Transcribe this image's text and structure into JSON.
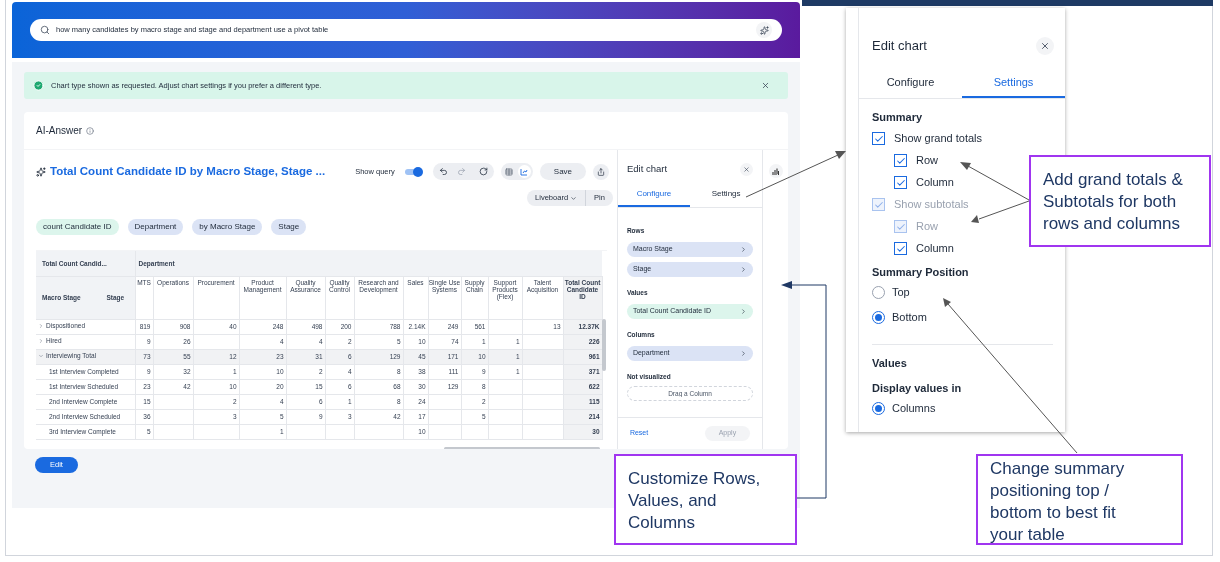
{
  "search": {
    "value": "how many candidates by macro stage and stage and department use a pivot table"
  },
  "notice": {
    "text": "Chart type shown as requested. Adjust chart settings if you prefer a different type."
  },
  "answer": {
    "title": "AI-Answer",
    "chart_title": "Total Count Candidate ID by Macro Stage, Stage ...",
    "show_query": {
      "label": "Show query",
      "on": true
    },
    "views": [
      {
        "kind": "table",
        "selected": false
      },
      {
        "kind": "chart",
        "selected": true
      }
    ],
    "save": "Save",
    "liveboard": "Liveboard",
    "pin": "Pin",
    "edit": "Edit",
    "chips": [
      {
        "label": "count Candidate ID",
        "kind": "measure"
      },
      {
        "label": "Department",
        "kind": "attribute"
      },
      {
        "label": "by Macro Stage",
        "kind": "attribute"
      },
      {
        "label": "Stage",
        "kind": "attribute"
      }
    ]
  },
  "table": {
    "corner": "Total Count Candid...",
    "group_header": "Department",
    "row_headers": [
      "Macro Stage",
      "Stage"
    ],
    "columns": [
      "MTS",
      "Operations",
      "Procurement",
      "Product Management",
      "Quality Assurance",
      "Quality Control",
      "Research and Development",
      "Sales",
      "Single Use Systems",
      "Supply Chain",
      "Support Products (Flex)",
      "Talent Acquisition",
      "Total Count Candidate ID"
    ],
    "rows": [
      {
        "label": "Dispositioned",
        "expanded": false,
        "cells": [
          {
            "text": "819"
          },
          {
            "text": "908"
          },
          {
            "text": "40"
          },
          {
            "text": "248"
          },
          {
            "text": "498"
          },
          {
            "text": "200"
          },
          {
            "text": "788"
          },
          {
            "text": "2.14K"
          },
          {
            "text": "249"
          },
          {
            "text": "561"
          },
          {},
          {
            "text": "13"
          },
          {
            "text": "12.37K"
          }
        ]
      },
      {
        "label": "Hired",
        "expanded": false,
        "cells": [
          {
            "text": "9"
          },
          {
            "text": "26"
          },
          {},
          {
            "text": "4"
          },
          {
            "text": "4"
          },
          {
            "text": "2"
          },
          {
            "text": "5"
          },
          {
            "text": "10"
          },
          {
            "text": "74"
          },
          {
            "text": "1"
          },
          {
            "text": "1"
          },
          {},
          {
            "text": "226"
          }
        ]
      },
      {
        "label": "Interviewing Total",
        "expanded": true,
        "cells": [
          {
            "text": "73"
          },
          {
            "text": "55"
          },
          {
            "text": "12"
          },
          {
            "text": "23"
          },
          {
            "text": "31"
          },
          {
            "text": "6"
          },
          {
            "text": "129"
          },
          {
            "text": "45"
          },
          {
            "text": "171"
          },
          {
            "text": "10"
          },
          {
            "text": "1"
          },
          {},
          {
            "text": "961"
          }
        ],
        "children": [
          {
            "label": "1st Interview Completed",
            "cells": [
              {
                "text": "9"
              },
              {
                "text": "32"
              },
              {
                "text": "1"
              },
              {
                "text": "10"
              },
              {
                "text": "2"
              },
              {
                "text": "4"
              },
              {
                "text": "8"
              },
              {
                "text": "38"
              },
              {
                "text": "111"
              },
              {
                "text": "9"
              },
              {
                "text": "1"
              },
              {},
              {
                "text": "371"
              }
            ]
          },
          {
            "label": "1st Interview Scheduled",
            "cells": [
              {
                "text": "23"
              },
              {
                "text": "42"
              },
              {
                "text": "10"
              },
              {
                "text": "20"
              },
              {
                "text": "15"
              },
              {
                "text": "6"
              },
              {
                "text": "68"
              },
              {
                "text": "30"
              },
              {
                "text": "129"
              },
              {
                "text": "8"
              },
              {},
              {},
              {
                "text": "622"
              }
            ]
          },
          {
            "label": "2nd Interview Complete",
            "cells": [
              {
                "text": "15"
              },
              {},
              {
                "text": "2"
              },
              {
                "text": "4"
              },
              {
                "text": "6"
              },
              {
                "text": "1"
              },
              {
                "text": "8"
              },
              {
                "text": "24"
              },
              {},
              {
                "text": "2"
              },
              {},
              {},
              {
                "text": "115"
              }
            ]
          },
          {
            "label": "2nd Interview Scheduled",
            "cells": [
              {
                "text": "36"
              },
              {},
              {
                "text": "3"
              },
              {
                "text": "5"
              },
              {
                "text": "9"
              },
              {
                "text": "3"
              },
              {
                "text": "42"
              },
              {
                "text": "17"
              },
              {},
              {
                "text": "5"
              },
              {},
              {},
              {
                "text": "214"
              }
            ]
          },
          {
            "label": "3rd Interview Complete",
            "cells": [
              {
                "text": "5"
              },
              {},
              {},
              {
                "text": "1"
              },
              {},
              {},
              {},
              {
                "text": "10"
              },
              {},
              {},
              {},
              {},
              {
                "text": "30"
              }
            ]
          }
        ]
      }
    ]
  },
  "edit_chart": {
    "title": "Edit chart",
    "tabs": [
      {
        "label": "Configure",
        "selected": true
      },
      {
        "label": "Settings",
        "selected": false
      }
    ],
    "sections": [
      {
        "title": "Rows",
        "items": [
          {
            "label": "Macro Stage",
            "kind": "attribute"
          },
          {
            "label": "Stage",
            "kind": "attribute"
          }
        ]
      },
      {
        "title": "Values",
        "items": [
          {
            "label": "Total Count Candidate ID",
            "kind": "measure"
          }
        ]
      },
      {
        "title": "Columns",
        "items": [
          {
            "label": "Department",
            "kind": "attribute"
          }
        ]
      }
    ],
    "not_visualized": {
      "title": "Not visualized",
      "placeholder": "Drag a Column"
    },
    "reset": "Reset",
    "apply": {
      "label": "Apply",
      "disabled": true
    }
  },
  "settings_panel": {
    "title": "Edit chart",
    "tabs": [
      {
        "label": "Configure",
        "selected": false
      },
      {
        "label": "Settings",
        "selected": true
      }
    ],
    "summary_title": "Summary",
    "options": [
      {
        "label": "Show grand totals",
        "checked": true,
        "disabled": false,
        "children": [
          {
            "label": "Row",
            "checked": true,
            "disabled": false
          },
          {
            "label": "Column",
            "checked": true,
            "disabled": false
          }
        ]
      },
      {
        "label": "Show subtotals",
        "checked": true,
        "disabled": true,
        "children": [
          {
            "label": "Row",
            "checked": true,
            "disabled": true
          },
          {
            "label": "Column",
            "checked": true,
            "disabled": false
          }
        ]
      }
    ],
    "position_title": "Summary Position",
    "positions": [
      {
        "label": "Top",
        "selected": false
      },
      {
        "label": "Bottom",
        "selected": true
      }
    ],
    "values_title": "Values",
    "display_title": "Display values in",
    "display": [
      {
        "label": "Columns",
        "selected": true
      }
    ]
  },
  "callouts": [
    {
      "text": "Add grand totals & Subtotals for both rows and columns"
    },
    {
      "text": "Customize Rows, Values, and Columns"
    },
    {
      "text": "Change summary positioning top / bottom to best fit your table"
    }
  ]
}
